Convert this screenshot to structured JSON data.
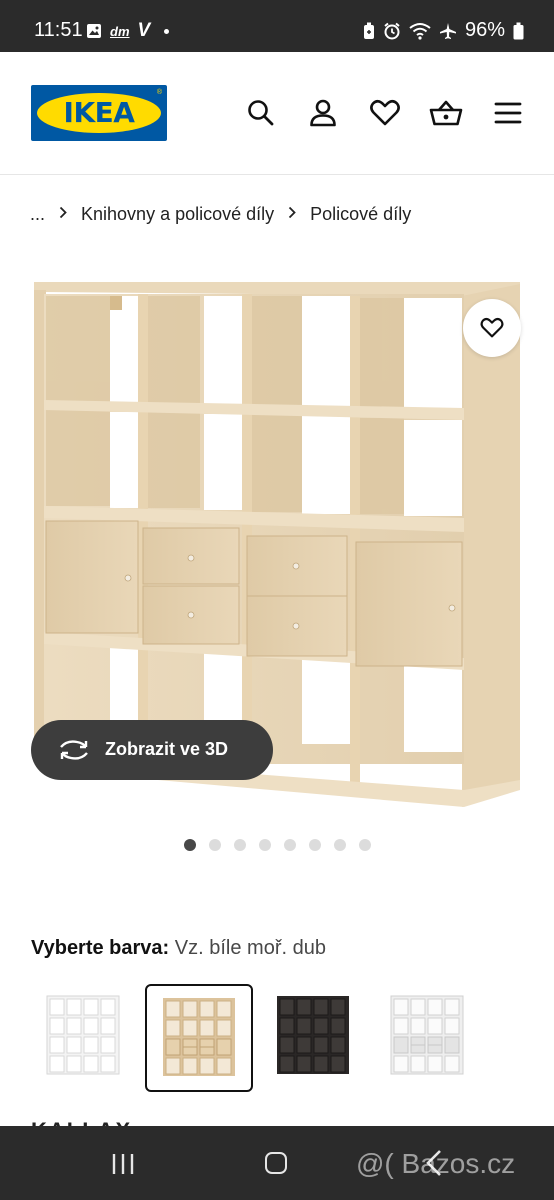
{
  "status_bar": {
    "time": "11:51",
    "left_icons": [
      "image-icon",
      "dm-icon",
      "v-icon",
      "dot-icon"
    ],
    "dm_text": "dm",
    "v_text": "V",
    "battery": "96%",
    "right_icons": [
      "battery-saver-icon",
      "alarm-icon",
      "wifi-icon",
      "airplane-icon",
      "battery-icon"
    ]
  },
  "header": {
    "logo_text": "IKEA",
    "logo_mark": "®",
    "icons": [
      "search-icon",
      "profile-icon",
      "favourites-icon",
      "basket-icon",
      "menu-icon"
    ]
  },
  "breadcrumb": {
    "ellipsis": "...",
    "items": [
      "Knihovny a policové díly",
      "Policové díly"
    ]
  },
  "gallery": {
    "view_3d_label": "Zobrazit ve 3D",
    "dots_count": 8,
    "active_dot": 0
  },
  "color_select": {
    "label": "Vyberte barva:",
    "value": "Vz. bíle moř. dub",
    "options": [
      "white",
      "white-stained-oak",
      "black-brown",
      "white-grey"
    ],
    "selected_index": 1
  },
  "colors": {
    "ikea_blue": "#0058a3",
    "ikea_yellow": "#ffdb00",
    "wood_light": "#e8d6b6",
    "system_bar": "#2b2b2b"
  },
  "partial_heading": "KALLAX",
  "nav_bar": {
    "icons": [
      "recents-icon",
      "home-icon",
      "back-icon"
    ]
  },
  "watermark": "@( Bazos.cz"
}
